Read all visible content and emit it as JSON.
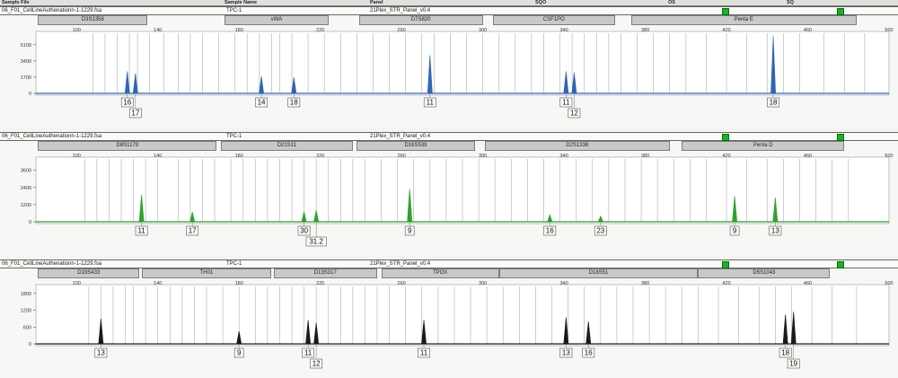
{
  "header": {
    "sample_file": "Sample File",
    "sample_name": "Sample Name",
    "panel": "Panel",
    "sqo": "SQO",
    "os": "OS",
    "sq": "SQ"
  },
  "x_scale": {
    "min": 80,
    "max": 500,
    "ticks": [
      100,
      140,
      180,
      220,
      260,
      300,
      340,
      380,
      420,
      460,
      500
    ]
  },
  "colors": {
    "blue": "#2e66b6",
    "green": "#2fa22c",
    "black": "#1a1a1a",
    "status": "#1eb024",
    "ladder": "#b9b9b9"
  },
  "panels": [
    {
      "file": "06_F01_CellLineAuthenationn-1-1229.fsa",
      "sample": "TPC-1",
      "panel": "21Plex_STR_Panel_v0.4",
      "color": "#2e66b6",
      "markers": [
        {
          "name": "D3S1358",
          "from": 81,
          "to": 135
        },
        {
          "name": "vWA",
          "from": 173,
          "to": 224
        },
        {
          "name": "D7S820",
          "from": 239,
          "to": 300
        },
        {
          "name": "CSF1PO",
          "from": 305,
          "to": 365
        },
        {
          "name": "Penta E",
          "from": 373,
          "to": 484
        }
      ],
      "y_ticks": [
        {
          "label": "5100",
          "v": 5100
        },
        {
          "label": "3400",
          "v": 3400
        },
        {
          "label": "1700",
          "v": 1700
        },
        {
          "label": "0",
          "v": 0
        }
      ],
      "y_max": 6300,
      "ladder_x": [
        108,
        114,
        120,
        126,
        130,
        136,
        143,
        150,
        156,
        162,
        170,
        178,
        184,
        190,
        196,
        200,
        206,
        214,
        222,
        230,
        238,
        246,
        254,
        262,
        270,
        276,
        284,
        292,
        300,
        308,
        316,
        324,
        330,
        338,
        344,
        350,
        356,
        362,
        368,
        376,
        384,
        392,
        400,
        410,
        420,
        430,
        440,
        448,
        456,
        468,
        478,
        488
      ],
      "peaks": [
        {
          "x": 125,
          "h": 2300
        },
        {
          "x": 129,
          "h": 2100
        },
        {
          "x": 191,
          "h": 1800
        },
        {
          "x": 207,
          "h": 1700
        },
        {
          "x": 274,
          "h": 4000
        },
        {
          "x": 341,
          "h": 2300
        },
        {
          "x": 345,
          "h": 2200
        },
        {
          "x": 443,
          "h": 6000
        }
      ],
      "alleles": [
        {
          "x": 125,
          "label": "16",
          "row": 0
        },
        {
          "x": 129,
          "label": "17",
          "row": 1
        },
        {
          "x": 191,
          "label": "14",
          "row": 0
        },
        {
          "x": 207,
          "label": "18",
          "row": 0
        },
        {
          "x": 274,
          "label": "11",
          "row": 0
        },
        {
          "x": 341,
          "label": "11",
          "row": 0
        },
        {
          "x": 345,
          "label": "12",
          "row": 1
        },
        {
          "x": 443,
          "label": "18",
          "row": 0
        }
      ]
    },
    {
      "file": "06_F01_CellLineAuthenationn-1-1229.fsa",
      "sample": "TPC-1",
      "panel": "21Plex_STR_Panel_v0.4",
      "color": "#2fa22c",
      "markers": [
        {
          "name": "D8S1179",
          "from": 81,
          "to": 169
        },
        {
          "name": "D21S11",
          "from": 171,
          "to": 236
        },
        {
          "name": "D16S539",
          "from": 238,
          "to": 296
        },
        {
          "name": "D2S1338",
          "from": 301,
          "to": 392
        },
        {
          "name": "Penta D",
          "from": 398,
          "to": 478
        }
      ],
      "y_ticks": [
        {
          "label": "3600",
          "v": 3600
        },
        {
          "label": "2400",
          "v": 2400
        },
        {
          "label": "1200",
          "v": 1200
        },
        {
          "label": "0",
          "v": 0
        }
      ],
      "y_max": 4400,
      "ladder_x": [
        104,
        110,
        116,
        122,
        128,
        134,
        140,
        150,
        156,
        162,
        168,
        176,
        182,
        188,
        194,
        200,
        206,
        212,
        218,
        224,
        230,
        236,
        242,
        250,
        258,
        266,
        274,
        282,
        290,
        298,
        306,
        314,
        322,
        330,
        338,
        346,
        354,
        362,
        370,
        378,
        386,
        394,
        402,
        410,
        420,
        430,
        440,
        448,
        456,
        464,
        472,
        480
      ],
      "peaks": [
        {
          "x": 132,
          "h": 1900
        },
        {
          "x": 157,
          "h": 700
        },
        {
          "x": 212,
          "h": 700
        },
        {
          "x": 218,
          "h": 800
        },
        {
          "x": 264,
          "h": 2300
        },
        {
          "x": 333,
          "h": 500
        },
        {
          "x": 358,
          "h": 400
        },
        {
          "x": 424,
          "h": 1800
        },
        {
          "x": 444,
          "h": 1700
        }
      ],
      "alleles": [
        {
          "x": 132,
          "label": "11",
          "row": 0
        },
        {
          "x": 157,
          "label": "17",
          "row": 0
        },
        {
          "x": 212,
          "label": "30",
          "row": 0
        },
        {
          "x": 218,
          "label": "31.2",
          "row": 1
        },
        {
          "x": 264,
          "label": "9",
          "row": 0
        },
        {
          "x": 333,
          "label": "16",
          "row": 0
        },
        {
          "x": 358,
          "label": "23",
          "row": 0
        },
        {
          "x": 424,
          "label": "9",
          "row": 0
        },
        {
          "x": 444,
          "label": "13",
          "row": 0
        }
      ]
    },
    {
      "file": "06_F01_CellLineAuthenationn-1-1229.fsa",
      "sample": "TPC-1",
      "panel": "21Plex_STR_Panel_v0.4",
      "color": "#1a1a1a",
      "markers": [
        {
          "name": "D19S433",
          "from": 81,
          "to": 131
        },
        {
          "name": "TH01",
          "from": 132,
          "to": 196
        },
        {
          "name": "D13S317",
          "from": 197,
          "to": 248
        },
        {
          "name": "TPOX",
          "from": 250,
          "to": 308
        },
        {
          "name": "D18S51",
          "from": 308,
          "to": 406
        },
        {
          "name": "D5S1043",
          "from": 406,
          "to": 471
        }
      ],
      "y_ticks": [
        {
          "label": "1800",
          "v": 1800
        },
        {
          "label": "1200",
          "v": 1200
        },
        {
          "label": "600",
          "v": 600
        },
        {
          "label": "0",
          "v": 0
        }
      ],
      "y_max": 2050,
      "ladder_x": [
        106,
        112,
        118,
        124,
        128,
        134,
        140,
        146,
        152,
        158,
        164,
        172,
        180,
        188,
        194,
        200,
        206,
        212,
        218,
        224,
        230,
        236,
        242,
        248,
        254,
        262,
        270,
        278,
        286,
        294,
        302,
        310,
        318,
        326,
        334,
        342,
        350,
        358,
        366,
        374,
        382,
        390,
        398,
        406,
        416,
        426,
        436,
        444,
        452,
        462,
        472,
        484
      ],
      "peaks": [
        {
          "x": 112,
          "h": 900
        },
        {
          "x": 180,
          "h": 450
        },
        {
          "x": 214,
          "h": 850
        },
        {
          "x": 218,
          "h": 750
        },
        {
          "x": 271,
          "h": 850
        },
        {
          "x": 341,
          "h": 950
        },
        {
          "x": 352,
          "h": 800
        },
        {
          "x": 449,
          "h": 1050
        },
        {
          "x": 453,
          "h": 1150
        }
      ],
      "alleles": [
        {
          "x": 112,
          "label": "13",
          "row": 0
        },
        {
          "x": 180,
          "label": "9",
          "row": 0
        },
        {
          "x": 214,
          "label": "11",
          "row": 0
        },
        {
          "x": 218,
          "label": "12",
          "row": 1
        },
        {
          "x": 271,
          "label": "11",
          "row": 0
        },
        {
          "x": 341,
          "label": "13",
          "row": 0
        },
        {
          "x": 352,
          "label": "16",
          "row": 0
        },
        {
          "x": 449,
          "label": "18",
          "row": 0
        },
        {
          "x": 453,
          "label": "19",
          "row": 1
        }
      ]
    }
  ]
}
